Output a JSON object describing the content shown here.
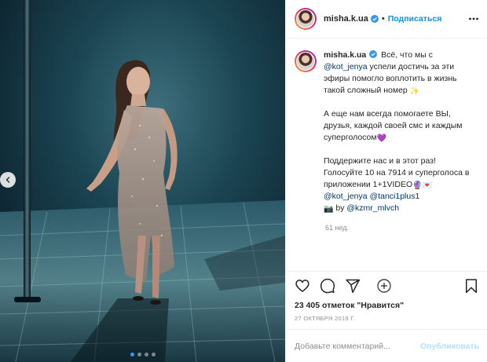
{
  "post": {
    "username": "misha.k.ua",
    "follow_label": "Подписаться",
    "header_separator": "•",
    "caption": {
      "username": "misha.k.ua",
      "p1_a": "Всё, что мы с",
      "p1_mention": "@kot_jenya",
      "p1_b": "успели достичь за эти эфиры помогло воплотить в жизнь такой сложный номер",
      "p1_emoji": "✨",
      "p2": "А еще нам всегда помогаете ВЫ, друзья, каждой своей смс и каждым суперголосом",
      "p2_emoji": "💜",
      "p3_a": "Поддержите нас и в этот раз! Голосуйте 10 на 7914 и суперголоса в приложении 1+1VIDEO",
      "p3_emoji1": "🔮",
      "p3_emoji2": "💌",
      "m1": "@kot_jenya",
      "m2": "@tanci1plus1",
      "credit_emoji": "📷",
      "credit_by": "by",
      "m3": "@kzmr_mlvch"
    },
    "caption_time": "61 нед.",
    "likes_count": "23 405",
    "likes_text": "отметок \"Нравится\"",
    "date": "27 ОКТЯБРЯ 2019 Г.",
    "comment_placeholder": "Добавьте комментарий...",
    "publish_label": "Опубликовать"
  },
  "carousel": {
    "total": 4,
    "current": 1
  },
  "icons": {
    "verified": "verified-badge-icon",
    "more": "more-options-icon",
    "prev": "chevron-left-icon",
    "like": "heart-outline-icon",
    "comment": "comment-bubble-icon",
    "share": "paper-plane-icon",
    "save": "bookmark-icon",
    "load_more": "plus-circle-icon"
  },
  "colors": {
    "accent": "#0095f6",
    "verified": "#3897f0",
    "publish_disabled": "#b2dffc",
    "muted": "#8e8e8e"
  }
}
